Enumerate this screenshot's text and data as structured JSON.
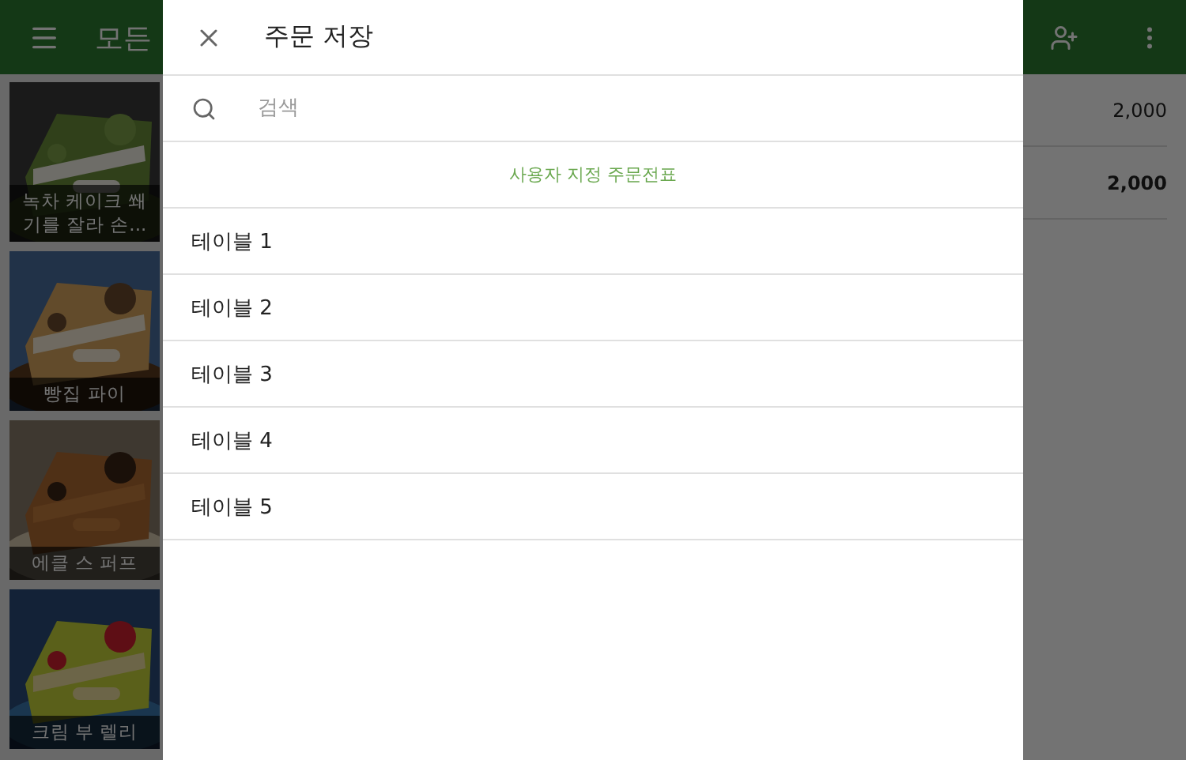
{
  "app_bar": {
    "title": "모든"
  },
  "products": [
    {
      "name": "녹차 케이크 쐐기를 잘라 손...",
      "kind": "picture"
    },
    {
      "name": "빵집 파이",
      "kind": "picture"
    },
    {
      "name": "에클 스 퍼프",
      "kind": "picture"
    },
    {
      "name": "크림 부 렐리",
      "kind": "picture"
    }
  ],
  "ticket": {
    "lines": [
      {
        "amount": "2,000",
        "bold": false
      },
      {
        "amount": "2,000",
        "bold": true
      }
    ]
  },
  "dialog": {
    "title": "주문 저장",
    "search": {
      "placeholder": "검색"
    },
    "custom_link": "사용자 지정 주문전표",
    "tickets": [
      {
        "label": "테이블 1"
      },
      {
        "label": "테이블 2"
      },
      {
        "label": "테이블 3"
      },
      {
        "label": "테이블 4"
      },
      {
        "label": "테이블 5"
      }
    ]
  }
}
